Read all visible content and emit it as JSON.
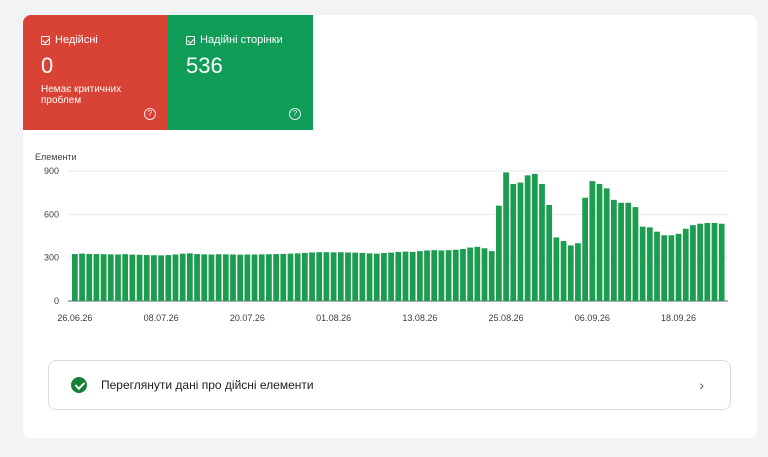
{
  "tiles": {
    "invalid": {
      "label": "Недійсні",
      "count": "0",
      "sub": "Немає критичних проблем",
      "help": "?"
    },
    "valid": {
      "label": "Надійні сторінки",
      "count": "536",
      "help": "?"
    }
  },
  "chart_data": {
    "type": "bar",
    "ylabel": "Елементи",
    "yticks": [
      "900",
      "600",
      "300",
      "0"
    ],
    "ylim": [
      0,
      900
    ],
    "xticks": [
      "26.06.26",
      "08.07.26",
      "20.07.26",
      "01.08.26",
      "13.08.26",
      "25.08.26",
      "06.09.26",
      "18.09.26"
    ],
    "categories": [
      "26.06.26",
      "27.06.26",
      "28.06.26",
      "29.06.26",
      "30.06.26",
      "01.07.26",
      "02.07.26",
      "03.07.26",
      "04.07.26",
      "05.07.26",
      "06.07.26",
      "07.07.26",
      "08.07.26",
      "09.07.26",
      "10.07.26",
      "11.07.26",
      "12.07.26",
      "13.07.26",
      "14.07.26",
      "15.07.26",
      "16.07.26",
      "17.07.26",
      "18.07.26",
      "19.07.26",
      "20.07.26",
      "21.07.26",
      "22.07.26",
      "23.07.26",
      "24.07.26",
      "25.07.26",
      "26.07.26",
      "27.07.26",
      "28.07.26",
      "29.07.26",
      "30.07.26",
      "31.07.26",
      "01.08.26",
      "02.08.26",
      "03.08.26",
      "04.08.26",
      "05.08.26",
      "06.08.26",
      "07.08.26",
      "08.08.26",
      "09.08.26",
      "10.08.26",
      "11.08.26",
      "12.08.26",
      "13.08.26",
      "14.08.26",
      "15.08.26",
      "16.08.26",
      "17.08.26",
      "18.08.26",
      "19.08.26",
      "20.08.26",
      "21.08.26",
      "22.08.26",
      "23.08.26",
      "24.08.26",
      "25.08.26",
      "26.08.26",
      "27.08.26",
      "28.08.26",
      "29.08.26",
      "30.08.26",
      "31.08.26",
      "01.09.26",
      "02.09.26",
      "03.09.26",
      "04.09.26",
      "05.09.26",
      "06.09.26",
      "07.09.26",
      "08.09.26",
      "09.09.26",
      "10.09.26",
      "11.09.26",
      "12.09.26",
      "13.09.26",
      "14.09.26",
      "15.09.26",
      "16.09.26",
      "17.09.26",
      "18.09.26",
      "19.09.26",
      "20.09.26",
      "21.09.26",
      "22.09.26",
      "23.09.26"
    ],
    "values": [
      325,
      328,
      326,
      325,
      324,
      323,
      322,
      324,
      321,
      320,
      318,
      317,
      316,
      318,
      322,
      328,
      330,
      325,
      323,
      322,
      324,
      323,
      322,
      321,
      322,
      322,
      323,
      324,
      325,
      326,
      328,
      330,
      333,
      336,
      338,
      338,
      337,
      338,
      336,
      335,
      333,
      330,
      328,
      332,
      335,
      340,
      342,
      340,
      345,
      350,
      352,
      350,
      352,
      355,
      360,
      370,
      375,
      365,
      345,
      660,
      890,
      810,
      820,
      870,
      880,
      810,
      665,
      440,
      415,
      385,
      400,
      715,
      830,
      810,
      780,
      700,
      680,
      680,
      650,
      515,
      510,
      480,
      455,
      455,
      465,
      500,
      525,
      535,
      540,
      540,
      535
    ]
  },
  "action": {
    "label": "Переглянути дані про дійсні елементи"
  },
  "colors": {
    "invalid": "#d94335",
    "valid": "#0f9d58",
    "bar": "#1b9c4f"
  }
}
